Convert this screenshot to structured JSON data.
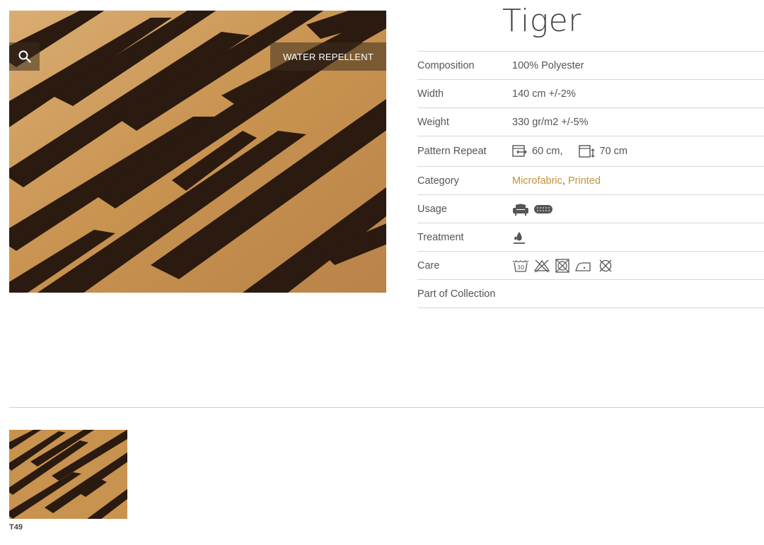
{
  "product": {
    "title": "Tiger",
    "badge": "WATER REPELLENT"
  },
  "specs": {
    "composition": {
      "label": "Composition",
      "value": "100% Polyester"
    },
    "width": {
      "label": "Width",
      "value": "140 cm +/-2%"
    },
    "weight": {
      "label": "Weight",
      "value": "330 gr/m2 +/-5%"
    },
    "pattern_repeat": {
      "label": "Pattern Repeat",
      "horizontal": "60 cm,",
      "vertical": "70 cm"
    },
    "category": {
      "label": "Category",
      "items": [
        "Microfabric",
        "Printed"
      ],
      "separator": ","
    },
    "usage": {
      "label": "Usage",
      "icons": [
        "armchair-icon",
        "cushion-icon"
      ]
    },
    "treatment": {
      "label": "Treatment",
      "icons": [
        "water-repellent-icon"
      ]
    },
    "care": {
      "label": "Care",
      "icons": [
        "wash-30-icon",
        "no-bleach-icon",
        "no-tumble-dry-icon",
        "iron-low-icon",
        "no-dry-clean-icon"
      ]
    },
    "collection": {
      "label": "Part of Collection",
      "value": ""
    }
  },
  "variants": [
    {
      "code": "T49"
    }
  ],
  "colors": {
    "accent_link": "#c4923a",
    "tiger_base": "#c99a5c",
    "tiger_stripe": "#2a1a10"
  }
}
